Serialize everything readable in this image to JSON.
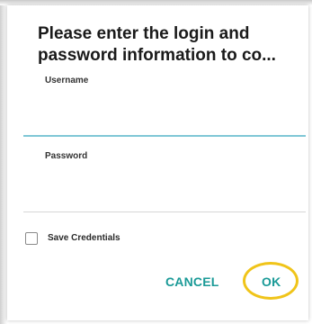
{
  "dialog": {
    "message": "Please enter the login and password information to co...",
    "username": {
      "label": "Username",
      "value": ""
    },
    "password": {
      "label": "Password",
      "value": ""
    },
    "save_credentials": {
      "label": "Save Credentials",
      "checked": false
    },
    "buttons": {
      "cancel": "CANCEL",
      "ok": "OK"
    },
    "colors": {
      "accent": "#1a9a97",
      "focused_underline": "#7fc7d6",
      "highlight_ring": "#f0c419"
    }
  }
}
